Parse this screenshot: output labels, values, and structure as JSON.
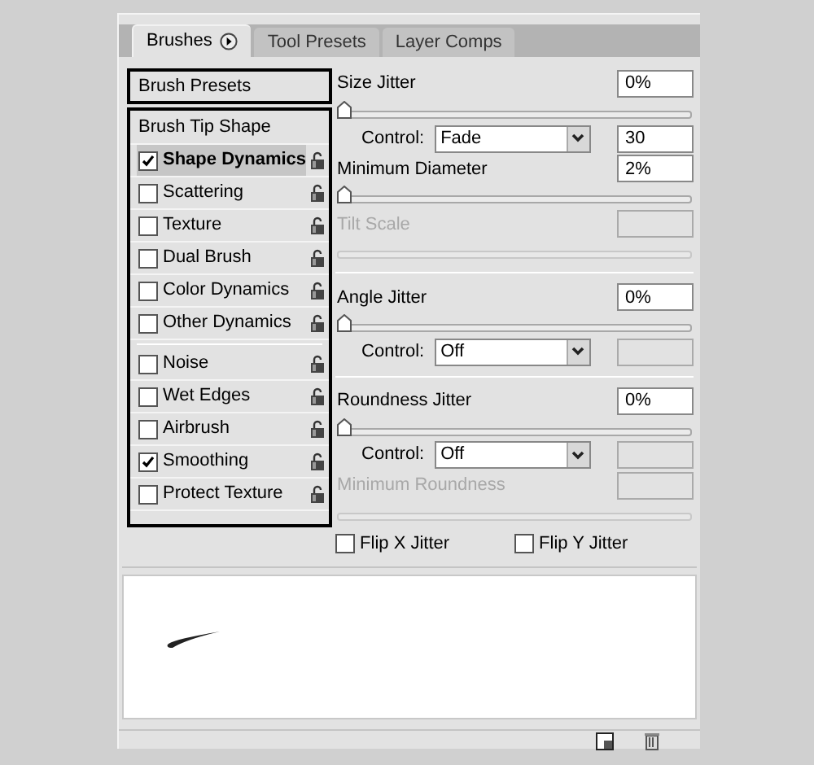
{
  "tabs": [
    {
      "label": "Brushes",
      "selected": true,
      "menu": true
    },
    {
      "label": "Tool Presets",
      "selected": false
    },
    {
      "label": "Layer Comps",
      "selected": false
    }
  ],
  "brush_presets": {
    "label": "Brush Presets"
  },
  "left_groups": [
    {
      "items": [
        {
          "kind": "header",
          "label": "Brush Tip Shape"
        },
        {
          "kind": "option",
          "label": "Shape Dynamics",
          "checked": true,
          "selected": true
        },
        {
          "kind": "option",
          "label": "Scattering",
          "checked": false,
          "selected": false
        },
        {
          "kind": "option",
          "label": "Texture",
          "checked": false,
          "selected": false
        },
        {
          "kind": "option",
          "label": "Dual Brush",
          "checked": false,
          "selected": false
        },
        {
          "kind": "option",
          "label": "Color Dynamics",
          "checked": false,
          "selected": false
        },
        {
          "kind": "option",
          "label": "Other Dynamics",
          "checked": false,
          "selected": false
        }
      ]
    },
    {
      "items": [
        {
          "kind": "option",
          "label": "Noise",
          "checked": false,
          "selected": false
        },
        {
          "kind": "option",
          "label": "Wet Edges",
          "checked": false,
          "selected": false
        },
        {
          "kind": "option",
          "label": "Airbrush",
          "checked": false,
          "selected": false
        },
        {
          "kind": "option",
          "label": "Smoothing",
          "checked": true,
          "selected": false
        },
        {
          "kind": "option",
          "label": "Protect Texture",
          "checked": false,
          "selected": false
        }
      ]
    }
  ],
  "settings": [
    {
      "kind": "field",
      "label": "Size Jitter",
      "value": "0%",
      "disabled": false
    },
    {
      "kind": "slider",
      "level": 0,
      "disabled": false
    },
    {
      "kind": "control",
      "label": "Control:",
      "option": "Fade",
      "value": "30"
    },
    {
      "kind": "field",
      "label": "Minimum Diameter",
      "value": "2%",
      "disabled": false
    },
    {
      "kind": "slider",
      "level": 0,
      "disabled": false
    },
    {
      "kind": "field",
      "label": "Tilt Scale",
      "disabled": true
    },
    {
      "kind": "slider",
      "disabled": true
    },
    {
      "kind": "divider"
    },
    {
      "kind": "field",
      "label": "Angle Jitter",
      "value": "0%",
      "disabled": false
    },
    {
      "kind": "slider",
      "level": 0,
      "disabled": false
    },
    {
      "kind": "control",
      "label": "Control:",
      "option": "Off"
    },
    {
      "kind": "divider"
    },
    {
      "kind": "field",
      "label": "Roundness Jitter",
      "value": "0%",
      "disabled": false
    },
    {
      "kind": "slider",
      "level": 0,
      "disabled": false
    },
    {
      "kind": "control",
      "label": "Control:",
      "option": "Off"
    },
    {
      "kind": "field",
      "label": "Minimum Roundness",
      "disabled": true
    },
    {
      "kind": "slider",
      "disabled": true
    },
    {
      "kind": "checks",
      "items": [
        {
          "label": "Flip X Jitter",
          "checked": false
        },
        {
          "label": "Flip Y Jitter",
          "checked": false
        }
      ]
    }
  ]
}
